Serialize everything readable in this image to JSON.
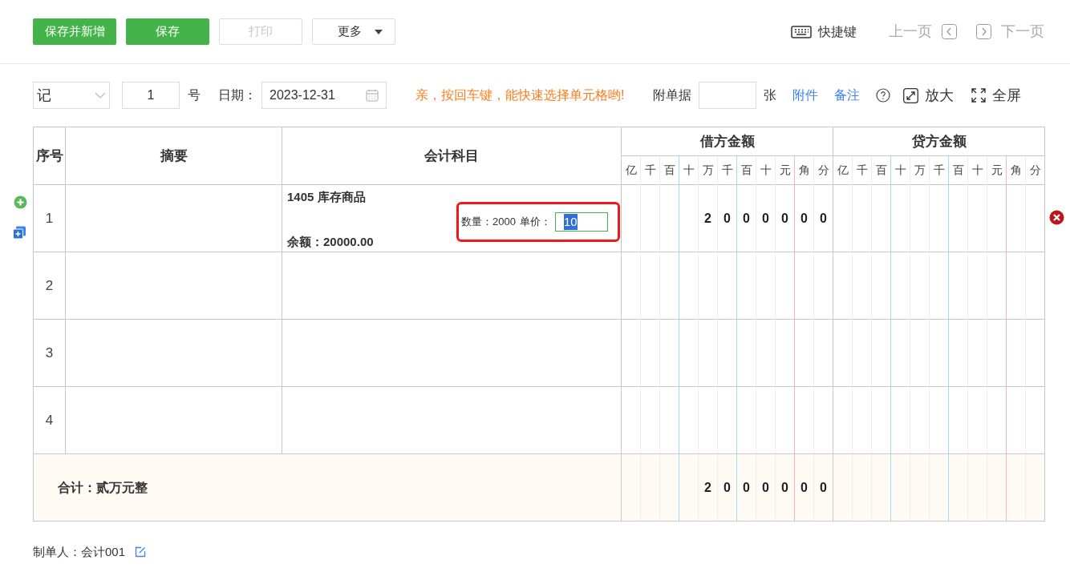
{
  "toolbar": {
    "buttons": [
      {
        "label": "保存并新增",
        "kind": "primary",
        "disabled": false
      },
      {
        "label": "保存",
        "kind": "primary",
        "disabled": false
      },
      {
        "label": "打印",
        "kind": "plain",
        "disabled": true
      },
      {
        "label": "更多",
        "kind": "dropdown",
        "disabled": false
      }
    ],
    "shortcut": "快捷键",
    "prev": {
      "label": "上一页",
      "disabled": true
    },
    "next": {
      "label": "下一页",
      "disabled": true
    }
  },
  "voucher": {
    "type": "记",
    "number": "1",
    "number_suffix": "号",
    "date_label": "日期：",
    "date": "2023-12-31",
    "hint": "亲，按回车键，能快速选择单元格哟!",
    "attachments_label": "附单据",
    "attachments_unit": "张",
    "links": [
      "附件",
      "备注"
    ],
    "zoom": "放大",
    "fullscreen": "全屏"
  },
  "table": {
    "columns": [
      "序号",
      "摘要",
      "会计科目"
    ],
    "debit_header": "借方金额",
    "credit_header": "贷方金额",
    "debit_units": [
      "亿",
      "千",
      "百",
      "十",
      "万",
      "千",
      "百",
      "十",
      "元",
      "角",
      "分"
    ],
    "credit_units": [
      "亿",
      "千",
      "百",
      "十",
      "万",
      "千",
      "百",
      "十",
      "元",
      "角",
      "分"
    ],
    "rows": [
      {
        "index": "1",
        "account": {
          "name": "1405 库存商品",
          "balance": "余额：20000.00",
          "quantity": "数量：2000",
          "price_label": "单价：",
          "price": "10"
        },
        "debit": [
          "2",
          "0",
          "0",
          "0",
          "0",
          "0",
          "0"
        ]
      },
      {
        "index": "2"
      },
      {
        "index": "3"
      },
      {
        "index": "4"
      }
    ],
    "total": {
      "label": "合计：贰万元整",
      "debit": [
        "2",
        "0",
        "0",
        "0",
        "0",
        "0",
        "0"
      ]
    }
  },
  "footer": {
    "maker": "制单人：会计001"
  }
}
